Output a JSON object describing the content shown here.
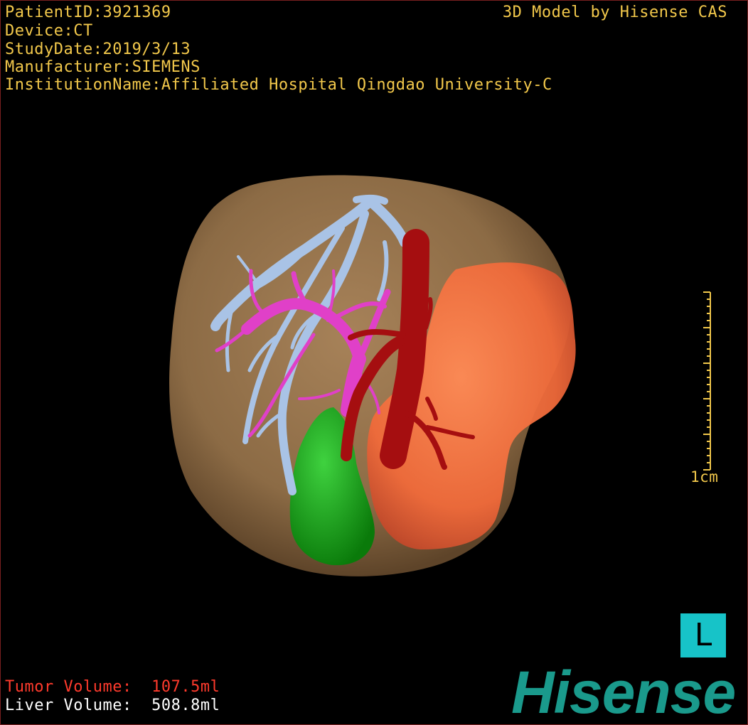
{
  "header": {
    "patient_id": "PatientID:3921369",
    "device": "Device:CT",
    "study_date": "StudyDate:2019/3/13",
    "manufacturer": "Manufacturer:SIEMENS",
    "institution": "InstitutionName:Affiliated Hospital Qingdao University-C",
    "credit": "3D Model by Hisense CAS"
  },
  "scale_bar": {
    "label": "1cm"
  },
  "orientation": {
    "label": "L"
  },
  "volumes": {
    "tumor": "Tumor Volume:  107.5ml",
    "liver": "Liver Volume:  508.8ml"
  },
  "brand": {
    "logo": "Hisense"
  },
  "colors": {
    "liver": "#8c6b45",
    "tumor": "#f06a3a",
    "artery": "#a50e10",
    "portal_vein": "#e040c8",
    "hepatic_vein": "#a9c3e6",
    "gallbladder": "#12a812",
    "overlay_text": "#f2c84b",
    "tumor_text": "#ff3a2c",
    "brand": "#1a9a8c",
    "orientation_box": "#17c3c8"
  }
}
